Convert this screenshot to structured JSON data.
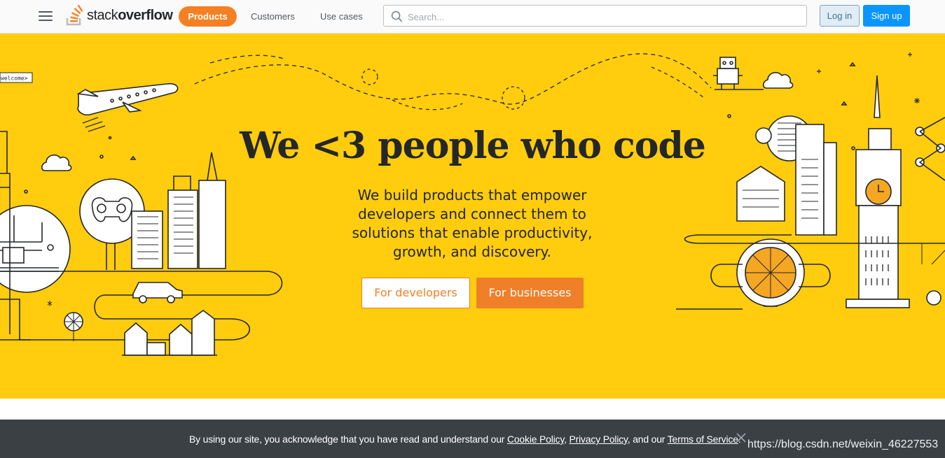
{
  "header": {
    "logo_text_light": "stack",
    "logo_text_bold": "overflow",
    "nav": {
      "products": "Products",
      "customers": "Customers",
      "use_cases": "Use cases"
    },
    "search": {
      "placeholder": "Search..."
    },
    "login": "Log in",
    "signup": "Sign up"
  },
  "hero": {
    "title": "We <3 people who code",
    "subtitle": "We build products that empower developers and connect them to solutions that enable productivity, growth, and discovery.",
    "btn_developers": "For developers",
    "btn_businesses": "For businesses",
    "sign_text": "welcome>"
  },
  "cookie": {
    "text_before": "By using our site, you acknowledge that you have read and understand our ",
    "cookie_policy": "Cookie Policy",
    "sep1": ", ",
    "privacy_policy": "Privacy Policy",
    "sep2": ", and our ",
    "terms": "Terms of Service",
    "text_after": "."
  },
  "watermark": "https://blog.csdn.net/weixin_46227553",
  "colors": {
    "accent_orange": "#f48024",
    "hero_yellow": "#ffcc0e",
    "signup_blue": "#0a95ff",
    "cookie_bg": "#3b4045"
  }
}
